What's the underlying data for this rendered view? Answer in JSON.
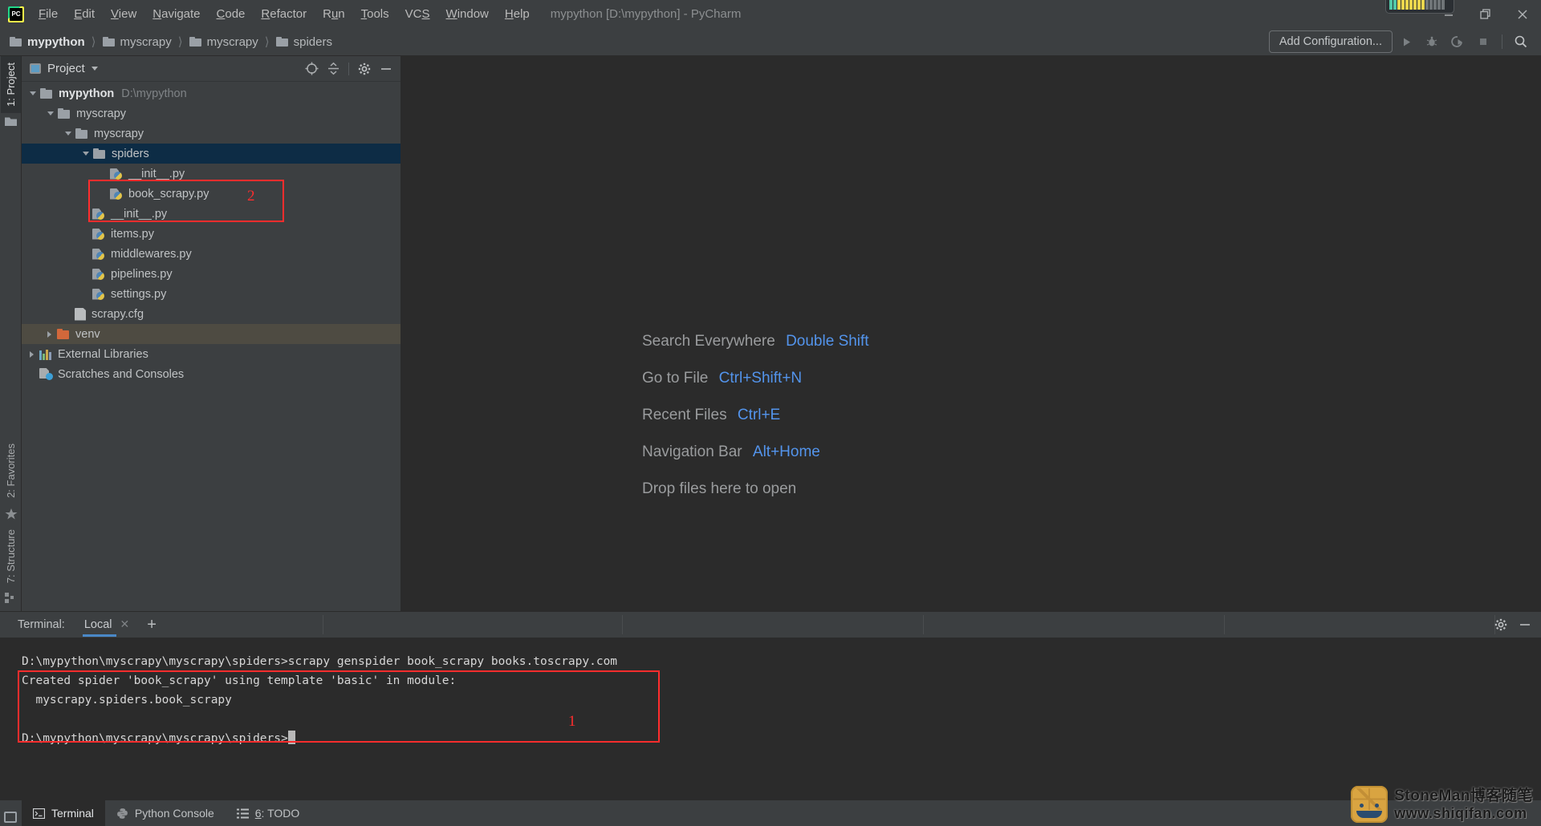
{
  "window": {
    "title": "mypython [D:\\mypython] - PyCharm",
    "logo_icon": "pycharm-logo-icon",
    "minimize_icon": "minimize-icon",
    "maximize_icon": "maximize-restore-icon",
    "close_icon": "close-icon"
  },
  "menu": [
    {
      "label": "File",
      "mnemonic": "F"
    },
    {
      "label": "Edit",
      "mnemonic": "E"
    },
    {
      "label": "View",
      "mnemonic": "V"
    },
    {
      "label": "Navigate",
      "mnemonic": "N"
    },
    {
      "label": "Code",
      "mnemonic": "C"
    },
    {
      "label": "Refactor",
      "mnemonic": "R"
    },
    {
      "label": "Run",
      "mnemonic": "n"
    },
    {
      "label": "Tools",
      "mnemonic": "T"
    },
    {
      "label": "VCS",
      "mnemonic": "S"
    },
    {
      "label": "Window",
      "mnemonic": "W"
    },
    {
      "label": "Help",
      "mnemonic": "H"
    }
  ],
  "breadcrumbs": [
    {
      "label": "mypython"
    },
    {
      "label": "myscrapy"
    },
    {
      "label": "myscrapy"
    },
    {
      "label": "spiders"
    }
  ],
  "toolbar": {
    "add_configuration": "Add Configuration...",
    "run_icon": "run-icon",
    "debug_icon": "debug-icon",
    "coverage_icon": "run-with-coverage-icon",
    "stop_icon": "stop-icon",
    "search_icon": "search-icon"
  },
  "left_strip": {
    "top": [
      {
        "label": "1: Project",
        "icon": "project-folder-icon",
        "selected": true
      }
    ],
    "bottom": [
      {
        "label": "2: Favorites",
        "icon": "star-icon"
      },
      {
        "label": "7: Structure",
        "icon": "structure-icon"
      }
    ]
  },
  "project_panel": {
    "title": "Project",
    "view_icon": "project-view-icon",
    "dropdown_icon": "chevron-down-icon",
    "locate_icon": "scroll-from-source-icon",
    "collapse_icon": "collapse-all-icon",
    "settings_icon": "gear-icon",
    "hide_icon": "hide-panel-icon",
    "tree": [
      {
        "label": "mypython",
        "path": "D:\\mypython",
        "indent": 0,
        "state": "open",
        "icon": "folder-icon",
        "bold": true
      },
      {
        "label": "myscrapy",
        "indent": 1,
        "state": "open",
        "icon": "folder-icon"
      },
      {
        "label": "myscrapy",
        "indent": 2,
        "state": "open",
        "icon": "folder-icon"
      },
      {
        "label": "spiders",
        "indent": 3,
        "state": "open",
        "icon": "folder-icon",
        "selected": true
      },
      {
        "label": "__init__.py",
        "indent": 4,
        "state": "leaf",
        "icon": "python-file-icon"
      },
      {
        "label": "book_scrapy.py",
        "indent": 4,
        "state": "leaf",
        "icon": "python-file-icon"
      },
      {
        "label": "__init__.py",
        "indent": 3,
        "state": "leaf",
        "icon": "python-file-icon"
      },
      {
        "label": "items.py",
        "indent": 3,
        "state": "leaf",
        "icon": "python-file-icon"
      },
      {
        "label": "middlewares.py",
        "indent": 3,
        "state": "leaf",
        "icon": "python-file-icon"
      },
      {
        "label": "pipelines.py",
        "indent": 3,
        "state": "leaf",
        "icon": "python-file-icon"
      },
      {
        "label": "settings.py",
        "indent": 3,
        "state": "leaf",
        "icon": "python-file-icon"
      },
      {
        "label": "scrapy.cfg",
        "indent": 2,
        "state": "leaf",
        "icon": "config-file-icon"
      },
      {
        "label": "venv",
        "indent": 1,
        "state": "closed",
        "icon": "folder-icon-orange",
        "excluded": true
      },
      {
        "label": "External Libraries",
        "indent": 0,
        "state": "closed",
        "icon": "library-icon"
      },
      {
        "label": "Scratches and Consoles",
        "indent": 0,
        "state": "leaf",
        "icon": "scratches-icon"
      }
    ]
  },
  "editor": {
    "hints": [
      {
        "label": "Search Everywhere",
        "shortcut": "Double Shift"
      },
      {
        "label": "Go to File",
        "shortcut": "Ctrl+Shift+N"
      },
      {
        "label": "Recent Files",
        "shortcut": "Ctrl+E"
      },
      {
        "label": "Navigation Bar",
        "shortcut": "Alt+Home"
      },
      {
        "label": "Drop files here to open",
        "shortcut": ""
      }
    ]
  },
  "terminal": {
    "label": "Terminal:",
    "tab": "Local",
    "close_icon": "close-icon",
    "add_icon": "plus-icon",
    "settings_icon": "gear-icon",
    "hide_icon": "hide-panel-icon",
    "lines": [
      "D:\\mypython\\myscrapy\\myscrapy\\spiders>scrapy genspider book_scrapy books.toscrapy.com",
      "Created spider 'book_scrapy' using template 'basic' in module:",
      "  myscrapy.spiders.book_scrapy",
      "",
      "D:\\mypython\\myscrapy\\myscrapy\\spiders>"
    ]
  },
  "statusbar": {
    "items": [
      {
        "label": "Terminal",
        "icon": "terminal-icon",
        "active": true
      },
      {
        "label": "Python Console",
        "icon": "python-icon",
        "active": false
      },
      {
        "label": "6: TODO",
        "icon": "todo-list-icon",
        "active": false
      }
    ]
  },
  "annotations": [
    {
      "number": "1",
      "target": "terminal-output"
    },
    {
      "number": "2",
      "target": "book-scrapy-file"
    }
  ],
  "watermark": {
    "line1": "StoneMan博客随笔",
    "line2": "www.shiqifan.com",
    "logo_icon": "turtle-logo-icon"
  },
  "colors": {
    "accent_blue": "#5394ec",
    "selection": "#0d2c45",
    "excluded": "#4e4b42",
    "panel_bg": "#3c3f41",
    "editor_bg": "#2b2b2b",
    "annotation_red": "#ff2d2d"
  }
}
